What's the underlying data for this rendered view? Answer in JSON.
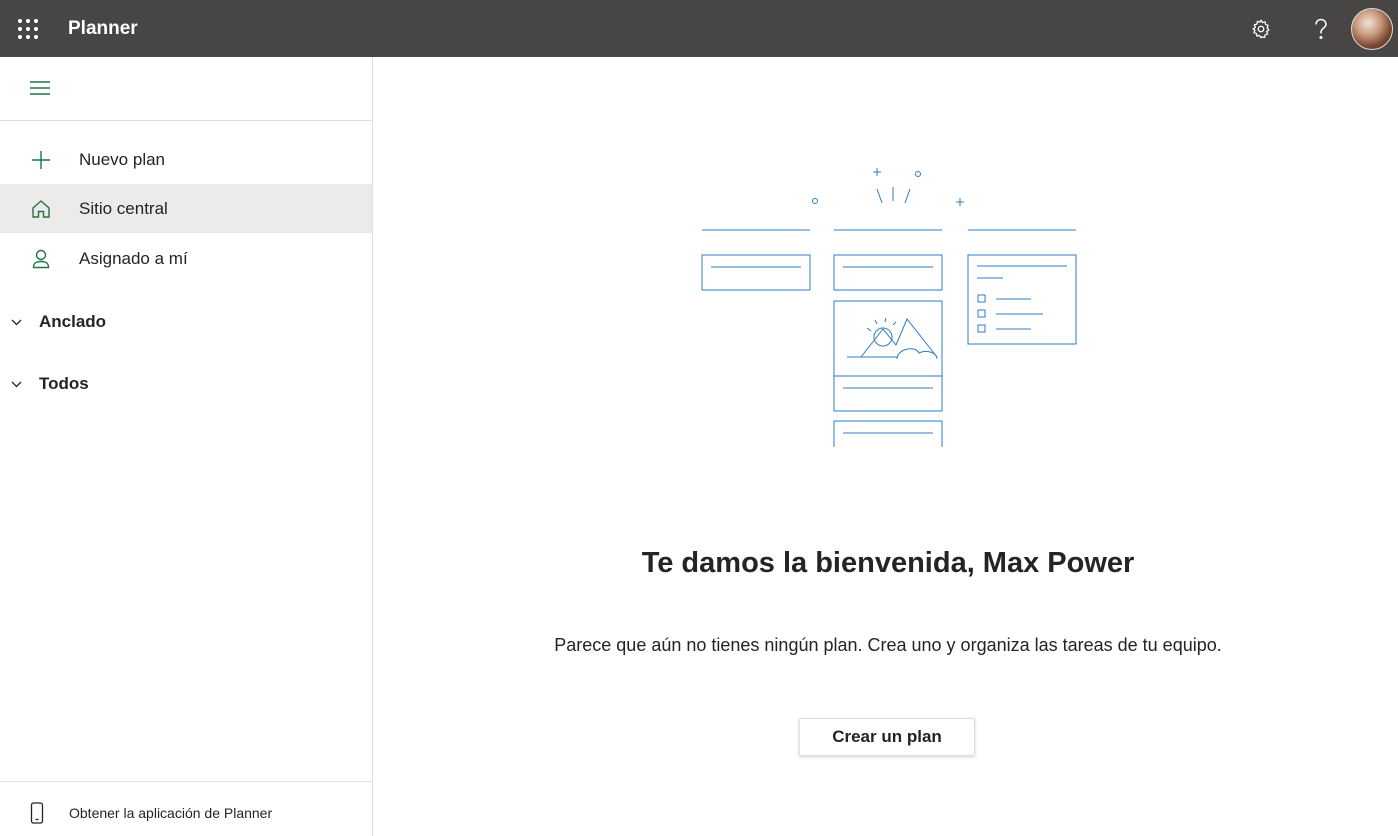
{
  "app": {
    "title": "Planner"
  },
  "header": {
    "icons": [
      "app-launcher-icon",
      "settings-icon",
      "help-icon",
      "avatar"
    ]
  },
  "sidebar": {
    "nav": [
      {
        "label": "Nuevo plan",
        "icon": "plus-icon"
      },
      {
        "label": "Sitio central",
        "icon": "home-icon",
        "active": true
      },
      {
        "label": "Asignado a mí",
        "icon": "person-icon"
      }
    ],
    "sections": [
      {
        "label": "Anclado",
        "icon": "chevron-down-icon"
      },
      {
        "label": "Todos",
        "icon": "chevron-down-icon"
      }
    ],
    "get_app": {
      "label": "Obtener la aplicación de Planner",
      "icon": "phone-icon"
    }
  },
  "main": {
    "welcome_title": "Te damos la bienvenida, Max Power",
    "subtitle": "Parece que aún no tienes ningún plan. Crea uno y organiza las tareas de tu equipo.",
    "create_button": "Crear un plan"
  },
  "colors": {
    "topbar": "#484644",
    "accent_green": "#217346",
    "illustration_blue": "#2e7bc4",
    "active_bg": "#edebe9"
  }
}
